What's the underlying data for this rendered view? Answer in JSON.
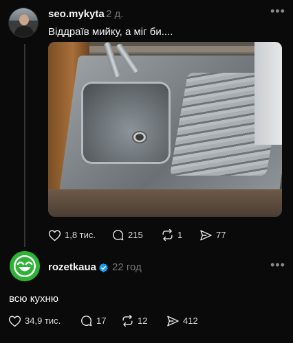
{
  "post1": {
    "username": "seo.mykyta",
    "time": "2 д.",
    "text": "Віддраїв мийку, а міг би....",
    "stats": {
      "likes": "1,8 тис.",
      "comments": "215",
      "reposts": "1",
      "shares": "77"
    }
  },
  "post2": {
    "username": "rozetkaua",
    "time": "22 год",
    "text": "всю кухню",
    "stats": {
      "likes": "34,9 тис.",
      "comments": "17",
      "reposts": "12",
      "shares": "412"
    }
  },
  "icons": {
    "more": "more-icon",
    "like": "heart-icon",
    "comment": "comment-icon",
    "repost": "repost-icon",
    "share": "share-icon",
    "verified": "verified-badge-icon"
  },
  "colors": {
    "background": "#0a0a0a",
    "text": "#f3f5f7",
    "muted": "#777777",
    "verified": "#1d9bf0",
    "rozetka_green": "#2fb336"
  }
}
